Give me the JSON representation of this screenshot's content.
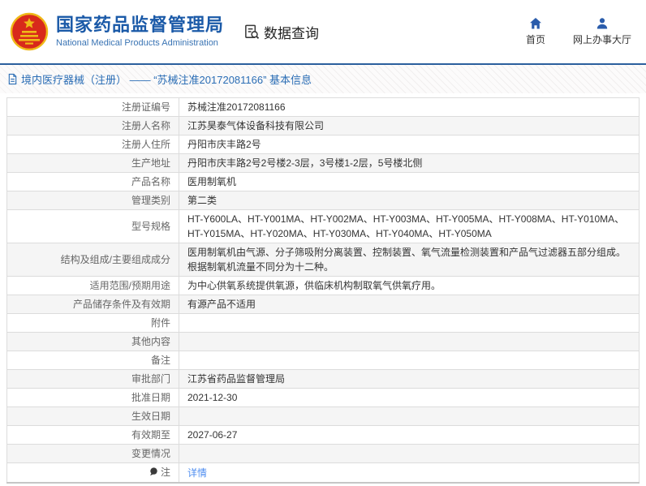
{
  "colors": {
    "brand_blue": "#1b5aa8",
    "divider_blue": "#2b5f9d",
    "nav_icon_blue": "#2a5cab",
    "breadcrumb_blue": "#2a6db5",
    "link_blue": "#4f8ef0",
    "row_alt_bg": "#f5f5f5",
    "border": "#dcdcdc"
  },
  "header": {
    "logo_icon": "china-national-emblem",
    "org_title": "国家药品监督管理局",
    "org_subtitle": "National Medical Products Administration",
    "section_icon": "document-search-icon",
    "section_title": "数据查询",
    "nav": [
      {
        "icon": "home-icon",
        "label": "首页"
      },
      {
        "icon": "person-icon",
        "label": "网上办事大厅"
      }
    ]
  },
  "breadcrumb": {
    "icon": "document-icon",
    "text": "境内医疗器械（注册） —— “苏械注准20172081166” 基本信息"
  },
  "detail_table": {
    "rows": [
      {
        "label": "注册证编号",
        "value": "苏械注准20172081166"
      },
      {
        "label": "注册人名称",
        "value": "江苏昊泰气体设备科技有限公司"
      },
      {
        "label": "注册人住所",
        "value": "丹阳市庆丰路2号"
      },
      {
        "label": "生产地址",
        "value": "丹阳市庆丰路2号2号楼2-3层，3号楼1-2层，5号楼北侧"
      },
      {
        "label": "产品名称",
        "value": "医用制氧机"
      },
      {
        "label": "管理类别",
        "value": "第二类"
      },
      {
        "label": "型号规格",
        "value": "HT-Y600LA、HT-Y001MA、HT-Y002MA、HT-Y003MA、HT-Y005MA、HT-Y008MA、HT-Y010MA、HT-Y015MA、HT-Y020MA、HT-Y030MA、HT-Y040MA、HT-Y050MA"
      },
      {
        "label": "结构及组成/主要组成成分",
        "value": "医用制氧机由气源、分子筛吸附分离装置、控制装置、氧气流量检测装置和产品气过滤器五部分组成。根据制氧机流量不同分为十二种。"
      },
      {
        "label": "适用范围/预期用途",
        "value": "为中心供氧系统提供氧源，供临床机构制取氧气供氧疗用。"
      },
      {
        "label": "产品储存条件及有效期",
        "value": "有源产品不适用"
      },
      {
        "label": "附件",
        "value": ""
      },
      {
        "label": "其他内容",
        "value": ""
      },
      {
        "label": "备注",
        "value": ""
      },
      {
        "label": "审批部门",
        "value": "江苏省药品监督管理局"
      },
      {
        "label": "批准日期",
        "value": "2021-12-30"
      },
      {
        "label": "生效日期",
        "value": ""
      },
      {
        "label": "有效期至",
        "value": "2027-06-27"
      },
      {
        "label": "变更情况",
        "value": ""
      },
      {
        "label": "注",
        "label_icon": "note-icon",
        "value": "详情",
        "value_type": "link"
      }
    ]
  }
}
